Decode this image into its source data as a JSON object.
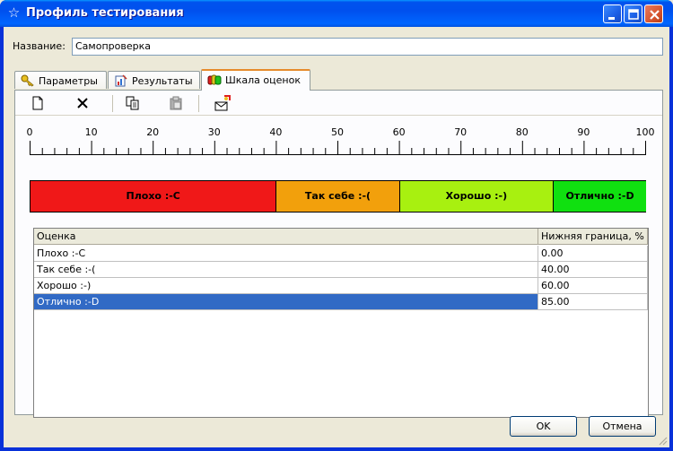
{
  "window": {
    "title": "Профиль тестирования"
  },
  "form": {
    "name_label": "Название:",
    "name_value": "Самопроверка"
  },
  "tabs": [
    {
      "label": "Параметры"
    },
    {
      "label": "Результаты"
    },
    {
      "label": "Шкала оценок",
      "active": true
    }
  ],
  "toolbar": {
    "icons": [
      "new-document-icon",
      "delete-icon",
      "copy-icon",
      "paste-icon",
      "import-icon"
    ]
  },
  "scale": {
    "ticks": [
      "0",
      "10",
      "20",
      "30",
      "40",
      "50",
      "60",
      "70",
      "80",
      "90",
      "100"
    ],
    "min": 0,
    "max": 100,
    "segments": [
      {
        "label": "Плохо :-С",
        "from": 0,
        "to": 40,
        "color": "#f01818"
      },
      {
        "label": "Так себе :-(",
        "from": 40,
        "to": 60,
        "color": "#f2a00c"
      },
      {
        "label": "Хорошо :-)",
        "from": 60,
        "to": 85,
        "color": "#a8f010"
      },
      {
        "label": "Отлично :-D",
        "from": 85,
        "to": 100,
        "color": "#10e010"
      }
    ]
  },
  "grid": {
    "headers": [
      "Оценка",
      "Нижняя граница, %"
    ],
    "rows": [
      {
        "grade": "Плохо :-С",
        "lower": "0.00"
      },
      {
        "grade": "Так себе :-(",
        "lower": "40.00"
      },
      {
        "grade": "Хорошо :-)",
        "lower": "60.00"
      },
      {
        "grade": "Отлично :-D",
        "lower": "85.00",
        "selected": true
      }
    ]
  },
  "buttons": {
    "ok": "OK",
    "cancel": "Отмена"
  }
}
